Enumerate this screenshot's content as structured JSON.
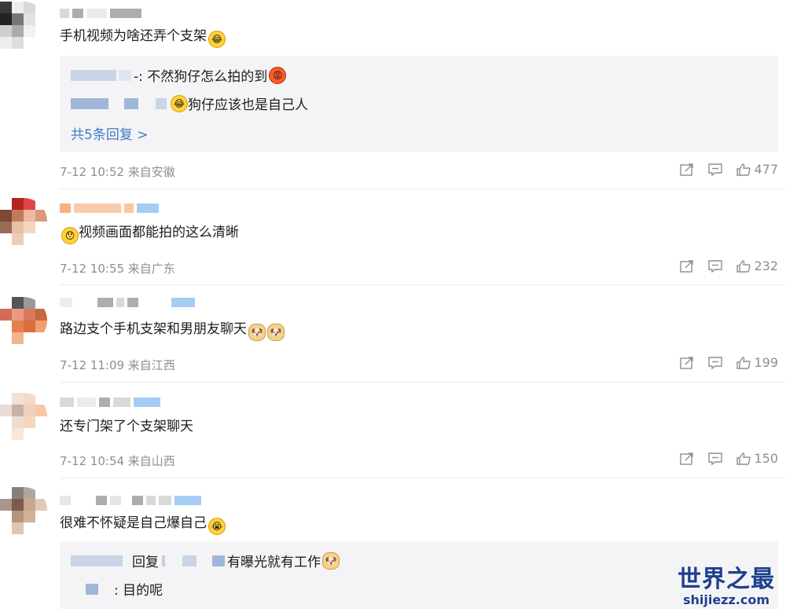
{
  "comments": [
    {
      "text": "手机视频为啥还弄个支架",
      "replies": [
        {
          "text": "-: 不然狗仔怎么拍的到"
        },
        {
          "text": "狗仔应该也是自己人"
        }
      ],
      "more_label": "共5条回复 >",
      "time": "7-12 10:52 来自安徽",
      "likes": "477"
    },
    {
      "text": "视频画面都能拍的这么清晰",
      "time": "7-12 10:55 来自广东",
      "likes": "232"
    },
    {
      "text": "路边支个手机支架和男朋友聊天",
      "time": "7-12 11:09 来自江西",
      "likes": "199"
    },
    {
      "text": "还专门架了个支架聊天",
      "time": "7-12 10:54 来自山西",
      "likes": "150"
    },
    {
      "text": "很难不怀疑是自己爆自己",
      "replies": [
        {
          "reply_word": "回复",
          "text": "有曝光就有工作"
        },
        {
          "text": ": 目的呢"
        }
      ]
    }
  ],
  "watermark": {
    "title": "世界之最",
    "url": "shijiezz.com"
  },
  "colors": {
    "link": "#3f7bc4",
    "meta": "#8e8e93",
    "reply_bg": "#f4f4f6",
    "watermark": "#1f3f8f"
  }
}
